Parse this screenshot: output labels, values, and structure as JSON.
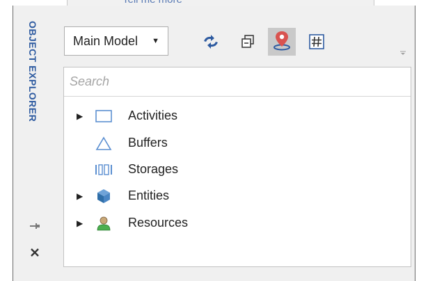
{
  "background_window": {
    "link_text": "Tell me more"
  },
  "panel": {
    "title": "OBJECT EXPLORER"
  },
  "toolbar": {
    "model_select": {
      "value": "Main Model"
    },
    "buttons": [
      {
        "icon": "sync-arrows-icon"
      },
      {
        "icon": "collapse-all-icon"
      },
      {
        "icon": "locate-pin-icon",
        "active": true
      },
      {
        "icon": "hash-icon"
      }
    ]
  },
  "search": {
    "placeholder": "Search"
  },
  "tree": {
    "items": [
      {
        "label": "Activities",
        "icon": "rectangle-icon",
        "expandable": true
      },
      {
        "label": "Buffers",
        "icon": "triangle-icon",
        "expandable": false
      },
      {
        "label": "Storages",
        "icon": "storage-icon",
        "expandable": false
      },
      {
        "label": "Entities",
        "icon": "cube-icon",
        "expandable": true
      },
      {
        "label": "Resources",
        "icon": "person-icon",
        "expandable": true
      }
    ]
  },
  "colors": {
    "accent": "#2d5aa0",
    "activities_icon": "#5b8fd1",
    "entities_icon": "#2f6ea8",
    "resources_icon": "#4caf50",
    "locate_pin": "#d9534f"
  }
}
